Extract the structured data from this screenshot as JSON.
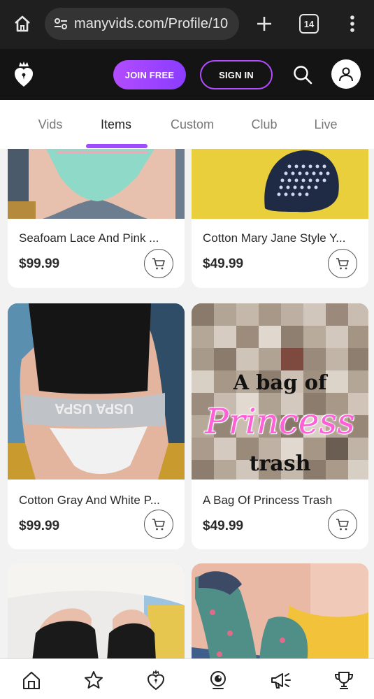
{
  "browser": {
    "url": "manyvids.com/Profile/10",
    "tab_count": "14"
  },
  "header": {
    "join_label": "JOIN FREE",
    "signin_label": "SIGN IN",
    "accent_color": "#b24cff"
  },
  "tabs": [
    {
      "label": "Vids",
      "active": false
    },
    {
      "label": "Items",
      "active": true
    },
    {
      "label": "Custom",
      "active": false
    },
    {
      "label": "Club",
      "active": false
    },
    {
      "label": "Live",
      "active": false
    }
  ],
  "products": [
    {
      "title": "Seafoam Lace And Pink ...",
      "price": "$99.99"
    },
    {
      "title": "Cotton Mary Jane Style Y...",
      "price": "$49.99"
    },
    {
      "title": "Cotton Gray And White P...",
      "price": "$99.99"
    },
    {
      "title": "A Bag Of Princess Trash",
      "price": "$49.99",
      "image_text": {
        "line1": "A bag of",
        "line2": "Princess",
        "line3": "trash"
      }
    },
    {
      "title": "",
      "price": ""
    },
    {
      "title": "",
      "price": ""
    }
  ],
  "bottom_nav": [
    {
      "icon": "home-icon"
    },
    {
      "icon": "star-icon"
    },
    {
      "icon": "manyvids-heart-icon"
    },
    {
      "icon": "webcam-icon"
    },
    {
      "icon": "megaphone-icon"
    },
    {
      "icon": "trophy-icon"
    }
  ]
}
